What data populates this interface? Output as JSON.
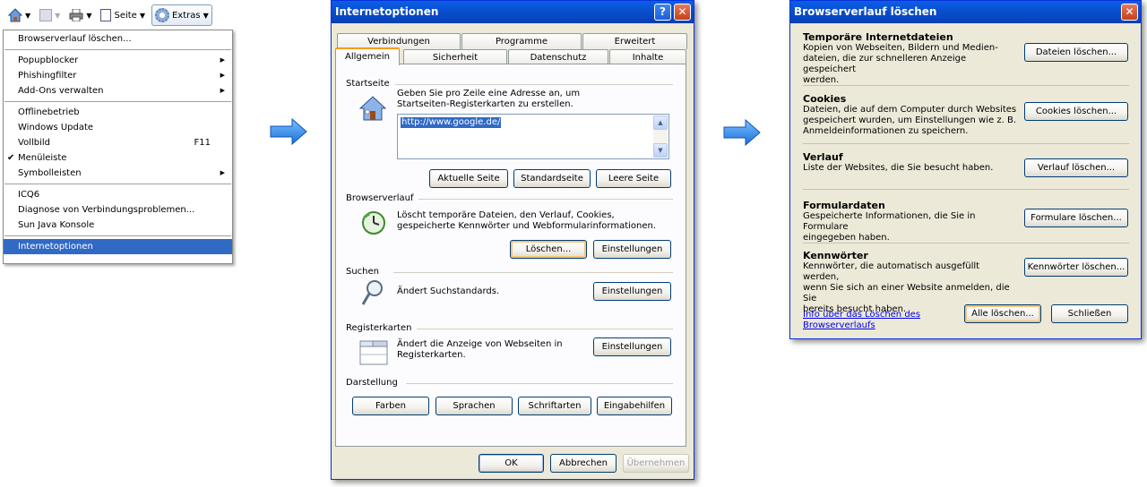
{
  "toolbar": {
    "page_label": "Seite",
    "extras_label": "Extras",
    "icons": [
      "home-icon",
      "feed-icon",
      "print-icon",
      "page-icon",
      "gear-icon"
    ]
  },
  "extras_menu": {
    "items": [
      {
        "label": "Browserverlauf löschen..."
      },
      {
        "sep": true
      },
      {
        "label": "Popupblocker",
        "submenu": true
      },
      {
        "label": "Phishingfilter",
        "submenu": true
      },
      {
        "label": "Add-Ons verwalten",
        "submenu": true
      },
      {
        "sep": true
      },
      {
        "label": "Offlinebetrieb"
      },
      {
        "label": "Windows Update"
      },
      {
        "label": "Vollbild",
        "shortcut": "F11"
      },
      {
        "label": "Menüleiste",
        "checked": true
      },
      {
        "label": "Symbolleisten",
        "submenu": true
      },
      {
        "sep": true
      },
      {
        "label": "ICQ6"
      },
      {
        "label": "Diagnose von Verbindungsproblemen..."
      },
      {
        "label": "Sun Java Konsole"
      },
      {
        "sep": true
      },
      {
        "label": "Internetoptionen",
        "selected": true
      }
    ]
  },
  "options_dialog": {
    "title": "Internetoptionen",
    "tabs_back": [
      "Verbindungen",
      "Programme",
      "Erweitert"
    ],
    "tabs_front": [
      "Allgemein",
      "Sicherheit",
      "Datenschutz",
      "Inhalte"
    ],
    "active_tab": "Allgemein",
    "startseite": {
      "title": "Startseite",
      "desc_1": "Geben Sie pro Zeile eine Adresse an, um",
      "desc_2": "Startseiten-Registerkarten zu erstellen.",
      "url": "http://www.google.de/",
      "btn_current": "Aktuelle Seite",
      "btn_default": "Standardseite",
      "btn_blank": "Leere Seite"
    },
    "browserverlauf": {
      "title": "Browserverlauf",
      "desc_1": "Löscht temporäre Dateien, den Verlauf, Cookies,",
      "desc_2": "gespeicherte Kennwörter und Webformularinformationen.",
      "btn_delete": "Löschen...",
      "btn_settings": "Einstellungen"
    },
    "suchen": {
      "title": "Suchen",
      "desc": "Ändert Suchstandards.",
      "btn_settings": "Einstellungen"
    },
    "registerkarten": {
      "title": "Registerkarten",
      "desc_1": "Ändert die Anzeige von Webseiten in",
      "desc_2": "Registerkarten.",
      "btn_settings": "Einstellungen"
    },
    "darstellung": {
      "title": "Darstellung",
      "btn_colors": "Farben",
      "btn_languages": "Sprachen",
      "btn_fonts": "Schriftarten",
      "btn_accessibility": "Eingabehilfen"
    },
    "footer": {
      "ok": "OK",
      "cancel": "Abbrechen",
      "apply": "Übernehmen"
    }
  },
  "delete_dialog": {
    "title": "Browserverlauf löschen",
    "sections": [
      {
        "title": "Temporäre Internetdateien",
        "lines": [
          "Kopien von Webseiten, Bildern und Medien-",
          "dateien, die zur schnelleren Anzeige gespeichert",
          "werden."
        ],
        "button": "Dateien löschen..."
      },
      {
        "title": "Cookies",
        "lines": [
          "Dateien, die auf dem Computer durch Websites",
          "gespeichert wurden, um Einstellungen wie z. B.",
          "Anmeldeinformationen zu speichern."
        ],
        "button": "Cookies löschen..."
      },
      {
        "title": "Verlauf",
        "lines": [
          "Liste der Websites, die Sie besucht haben."
        ],
        "button": "Verlauf löschen..."
      },
      {
        "title": "Formulardaten",
        "lines": [
          "Gespeicherte Informationen, die Sie in Formulare",
          "eingegeben haben."
        ],
        "button": "Formulare löschen..."
      },
      {
        "title": "Kennwörter",
        "lines": [
          "Kennwörter, die automatisch ausgefüllt werden,",
          "wenn Sie sich an einer Website anmelden, die Sie",
          "bereits besucht haben."
        ],
        "button": "Kennwörter löschen..."
      }
    ],
    "info_link_1": "Info über das Löschen des",
    "info_link_2": "Browserverlaufs",
    "btn_delete_all": "Alle löschen...",
    "btn_close": "Schließen"
  }
}
